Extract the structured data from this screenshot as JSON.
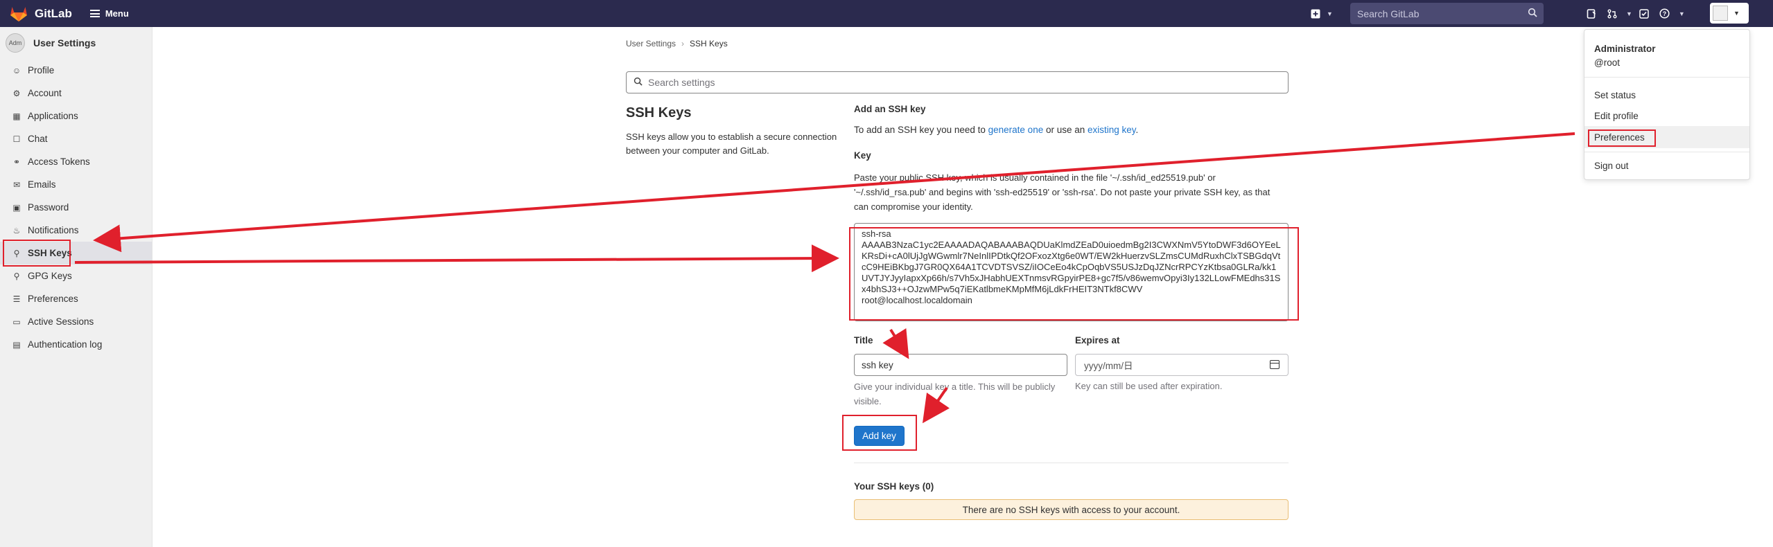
{
  "navbar": {
    "brand": "GitLab",
    "menu_label": "Menu",
    "search_placeholder": "Search GitLab",
    "background": "#2b2a4e"
  },
  "sidebar": {
    "context_avatar": "Adm",
    "context_title": "User Settings",
    "items": [
      {
        "label": "Profile",
        "icon": "profile-icon"
      },
      {
        "label": "Account",
        "icon": "account-icon"
      },
      {
        "label": "Applications",
        "icon": "applications-icon"
      },
      {
        "label": "Chat",
        "icon": "chat-icon"
      },
      {
        "label": "Access Tokens",
        "icon": "token-icon"
      },
      {
        "label": "Emails",
        "icon": "mail-icon"
      },
      {
        "label": "Password",
        "icon": "lock-icon"
      },
      {
        "label": "Notifications",
        "icon": "bell-icon"
      },
      {
        "label": "SSH Keys",
        "icon": "key-icon",
        "active": true
      },
      {
        "label": "GPG Keys",
        "icon": "gpg-key-icon"
      },
      {
        "label": "Preferences",
        "icon": "preferences-icon"
      },
      {
        "label": "Active Sessions",
        "icon": "monitor-icon"
      },
      {
        "label": "Authentication log",
        "icon": "log-icon"
      }
    ]
  },
  "breadcrumb": {
    "parent": "User Settings",
    "current": "SSH Keys"
  },
  "settings_search": {
    "placeholder": "Search settings"
  },
  "ssh_section": {
    "title": "SSH Keys",
    "description": "SSH keys allow you to establish a secure connection between your computer and GitLab."
  },
  "add_key": {
    "heading": "Add an SSH key",
    "intro_before": "To add an SSH key you need to ",
    "intro_link1": "generate one",
    "intro_middle": " or use an ",
    "intro_link2": "existing key",
    "intro_after": ".",
    "key_label": "Key",
    "key_help": "Paste your public SSH key, which is usually contained in the file '~/.ssh/id_ed25519.pub' or '~/.ssh/id_rsa.pub' and begins with 'ssh-ed25519' or 'ssh-rsa'. Do not paste your private SSH key, as that can compromise your identity.",
    "key_value_lines": [
      "ssh-rsa",
      "AAAAB3NzaC1yc2EAAAADAQABAAABAQDUaKlmdZEaD0uioedmBg2I3CWXNmV5YtoDWF3d6OYEeLKRsDi+cA0lUjJgWGwmlr7NeInlIPDtkQf2OFxozXtg6e0WT/EW2kHuerzvSLZmsCUMdRuxhClxTSBGdqVtcC9HEiBKbgJ7GR0QX64A1TCVDTSVSZ/iIOCeEo4kCpOqbVS5USJzDqJZNcrRPCYzKtbsa0GLRa/kk1UVTJYJyyIapxXp66h/s7Vh5xJHabhUEXTnmsvRGpyirPE8+gc7f5/v86wemvOpyi3Iy132LLowFMEdhs31Sx4bhSJ3++OJzwMPw5q7iEKatlbmeKMpMfM6jLdkFrHEIT3NTkf8CWV",
      "root@localhost.localdomain"
    ],
    "title_label": "Title",
    "title_value": "ssh key",
    "title_help": "Give your individual key a title. This will be publicly visible.",
    "expires_label": "Expires at",
    "expires_placeholder": "yyyy/mm/日",
    "expires_help": "Key can still be used after expiration.",
    "submit_label": "Add key"
  },
  "your_keys": {
    "heading": "Your SSH keys (0)",
    "empty_message": "There are no SSH keys with access to your account."
  },
  "user_dropdown": {
    "name": "Administrator",
    "username": "@root",
    "items": [
      "Set status",
      "Edit profile",
      "Preferences",
      "Sign out"
    ]
  },
  "colors": {
    "accent": "#1f75cb",
    "annotation": "#e0202c",
    "warning_bg": "#fdf1dd"
  }
}
